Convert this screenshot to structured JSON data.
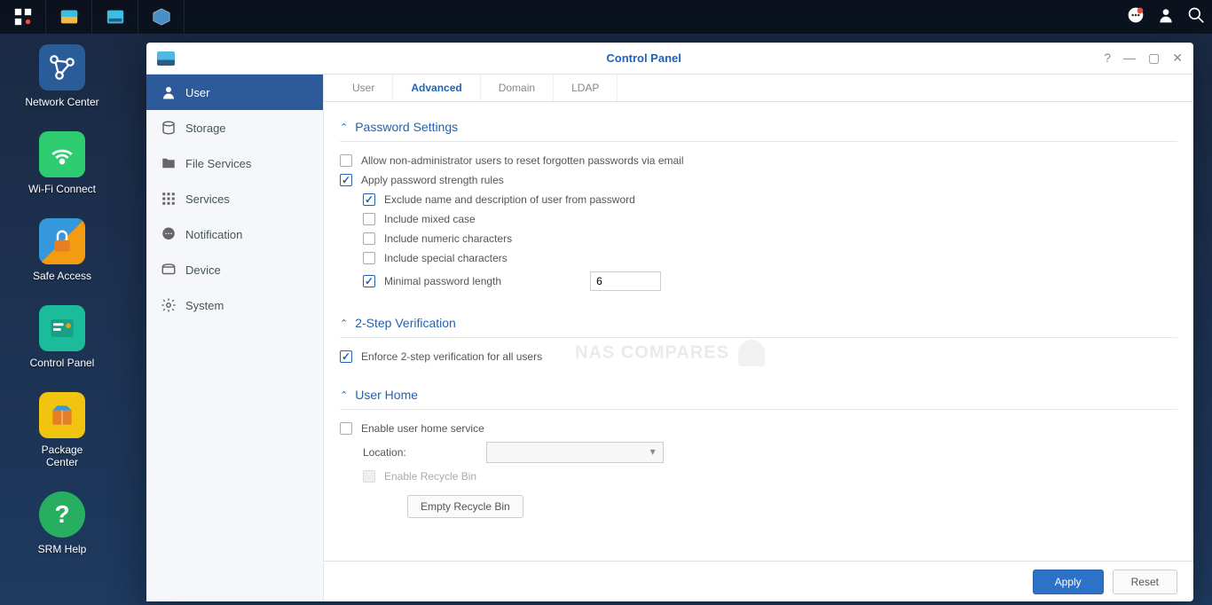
{
  "taskbar": {
    "apps": [
      "apps-icon",
      "file-station-icon",
      "control-panel-icon",
      "package-icon"
    ]
  },
  "desktop": [
    {
      "label": "Network Center"
    },
    {
      "label": "Wi-Fi Connect"
    },
    {
      "label": "Safe Access"
    },
    {
      "label": "Control Panel"
    },
    {
      "label": "Package\nCenter"
    },
    {
      "label": "SRM Help"
    }
  ],
  "window": {
    "title": "Control Panel"
  },
  "sidebar": [
    {
      "label": "User",
      "active": true
    },
    {
      "label": "Storage"
    },
    {
      "label": "File Services"
    },
    {
      "label": "Services"
    },
    {
      "label": "Notification"
    },
    {
      "label": "Device"
    },
    {
      "label": "System"
    }
  ],
  "tabs": [
    {
      "label": "User"
    },
    {
      "label": "Advanced",
      "active": true
    },
    {
      "label": "Domain"
    },
    {
      "label": "LDAP"
    }
  ],
  "sections": {
    "password": {
      "title": "Password Settings",
      "allow_reset": "Allow non-administrator users to reset forgotten passwords via email",
      "apply_rules": "Apply password strength rules",
      "exclude_name": "Exclude name and description of user from password",
      "mixed_case": "Include mixed case",
      "numeric": "Include numeric characters",
      "special": "Include special characters",
      "min_length": "Minimal password length",
      "min_length_value": "6"
    },
    "twostep": {
      "title": "2-Step Verification",
      "enforce": "Enforce 2-step verification for all users"
    },
    "userhome": {
      "title": "User Home",
      "enable": "Enable user home service",
      "location": "Location:",
      "recycle": "Enable Recycle Bin",
      "empty": "Empty Recycle Bin"
    }
  },
  "footer": {
    "apply": "Apply",
    "reset": "Reset"
  },
  "watermark": "NAS COMPARES"
}
